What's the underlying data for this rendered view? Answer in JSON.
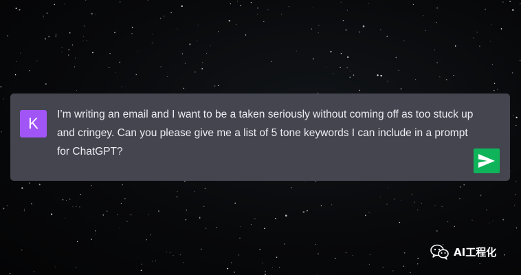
{
  "prompt_card": {
    "avatar_letter": "K",
    "message": "I’m writing an email and I want to be a taken seriously without coming off as too stuck up and cringey. Can you please give me a list of 5 tone keywords I can include in a prompt for ChatGPT?",
    "send_icon": "send-arrow-icon"
  },
  "watermark": {
    "icon": "wechat-icon",
    "text": "AI工程化"
  },
  "colors": {
    "card_background": "#44454f",
    "avatar_background": "#a155f7",
    "send_button": "#0fb45a",
    "text": "#ececf1"
  }
}
